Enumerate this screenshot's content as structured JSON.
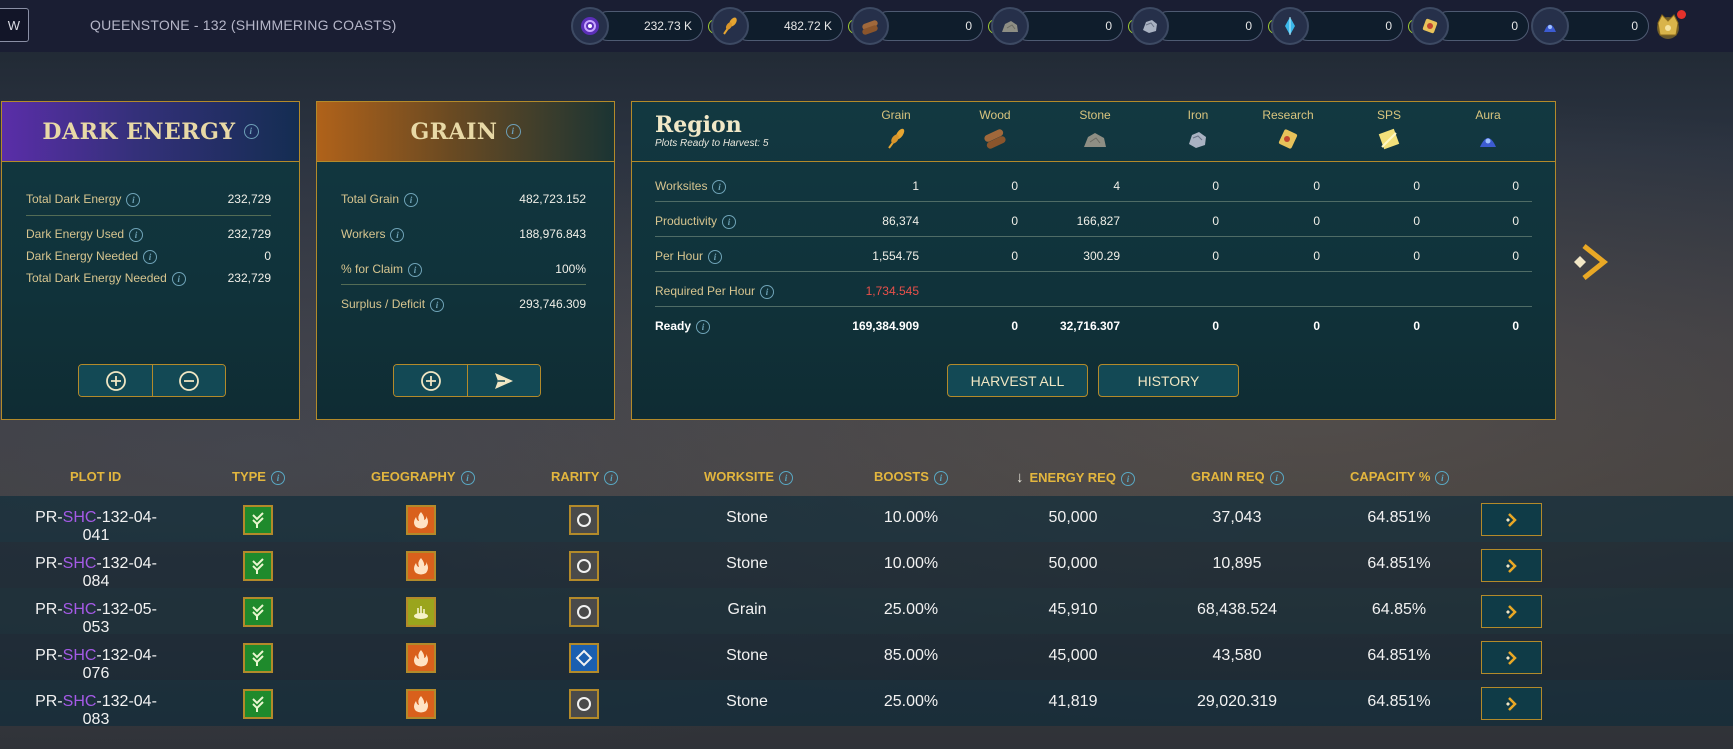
{
  "topbar": {
    "back_label": "W",
    "region_title": "QUEENSTONE - 132 (SHIMMERING COASTS)",
    "resources": [
      {
        "name": "dark-energy",
        "value": "232.73 K",
        "color": "#8b5cf6"
      },
      {
        "name": "grain",
        "value": "482.72 K",
        "color": "#e6a531"
      },
      {
        "name": "wood",
        "value": "0",
        "color": "#a0683b"
      },
      {
        "name": "stone",
        "value": "0",
        "color": "#8e8e84"
      },
      {
        "name": "iron",
        "value": "0",
        "color": "#a9b2c2"
      },
      {
        "name": "research",
        "value": "0",
        "color": "#3ab6e8"
      },
      {
        "name": "sps",
        "value": "0",
        "color": "#e8c25a"
      },
      {
        "name": "aura",
        "value": "0",
        "color": "#3c5bd1"
      }
    ]
  },
  "dark_energy": {
    "title": "DARK ENERGY",
    "stats": [
      {
        "label": "Total Dark Energy",
        "value": "232,729"
      },
      {
        "label": "Dark Energy Used",
        "value": "232,729"
      },
      {
        "label": "Dark Energy Needed",
        "value": "0"
      },
      {
        "label": "Total Dark Energy Needed",
        "value": "232,729"
      }
    ]
  },
  "grain": {
    "title": "GRAIN",
    "stats": [
      {
        "label": "Total Grain",
        "value": "482,723.152"
      },
      {
        "label": "Workers",
        "value": "188,976.843"
      },
      {
        "label": "% for Claim",
        "value": "100%"
      },
      {
        "label": "Surplus / Deficit",
        "value": "293,746.309"
      }
    ]
  },
  "region": {
    "title": "Region",
    "subtitle": "Plots Ready to Harvest: 5",
    "columns": [
      "Grain",
      "Wood",
      "Stone",
      "Iron",
      "Research",
      "SPS",
      "Aura"
    ],
    "rows": [
      {
        "label": "Worksites",
        "values": [
          "1",
          "0",
          "4",
          "0",
          "0",
          "0",
          "0"
        ]
      },
      {
        "label": "Productivity",
        "values": [
          "86,374",
          "0",
          "166,827",
          "0",
          "0",
          "0",
          "0"
        ]
      },
      {
        "label": "Per Hour",
        "values": [
          "1,554.75",
          "0",
          "300.29",
          "0",
          "0",
          "0",
          "0"
        ]
      },
      {
        "label": "Required Per Hour",
        "values": [
          "1,734.545",
          "",
          "",
          "",
          "",
          "",
          ""
        ]
      },
      {
        "label": "Ready",
        "values": [
          "169,384.909",
          "0",
          "32,716.307",
          "0",
          "0",
          "0",
          "0"
        ]
      }
    ],
    "harvest_label": "HARVEST ALL",
    "history_label": "HISTORY"
  },
  "plots": {
    "headers": {
      "plot_id": "PLOT ID",
      "type": "TYPE",
      "geography": "GEOGRAPHY",
      "rarity": "RARITY",
      "worksite": "WORKSITE",
      "boosts": "BOOSTS",
      "energy_req": "ENERGY REQ",
      "grain_req": "GRAIN REQ",
      "capacity": "CAPACITY %"
    },
    "sort_indicator": "↓",
    "rows": [
      {
        "prefix": "PR-",
        "code": "SHC",
        "suffix": "-132-04-041",
        "geography": "fire",
        "rarity": "common",
        "worksite": "Stone",
        "boosts": "10.00%",
        "energy_req": "50,000",
        "grain_req": "37,043",
        "capacity": "64.851%"
      },
      {
        "prefix": "PR-",
        "code": "SHC",
        "suffix": "-132-04-084",
        "geography": "fire",
        "rarity": "common",
        "worksite": "Stone",
        "boosts": "10.00%",
        "energy_req": "50,000",
        "grain_req": "10,895",
        "capacity": "64.851%"
      },
      {
        "prefix": "PR-",
        "code": "SHC",
        "suffix": "-132-05-053",
        "geography": "bog",
        "rarity": "common",
        "worksite": "Grain",
        "boosts": "25.00%",
        "energy_req": "45,910",
        "grain_req": "68,438.524",
        "capacity": "64.85%"
      },
      {
        "prefix": "PR-",
        "code": "SHC",
        "suffix": "-132-04-076",
        "geography": "fire",
        "rarity": "rare",
        "worksite": "Stone",
        "boosts": "85.00%",
        "energy_req": "45,000",
        "grain_req": "43,580",
        "capacity": "64.851%"
      },
      {
        "prefix": "PR-",
        "code": "SHC",
        "suffix": "-132-04-083",
        "geography": "fire",
        "rarity": "common",
        "worksite": "Stone",
        "boosts": "25.00%",
        "energy_req": "41,819",
        "grain_req": "29,020.319",
        "capacity": "64.851%"
      }
    ]
  }
}
